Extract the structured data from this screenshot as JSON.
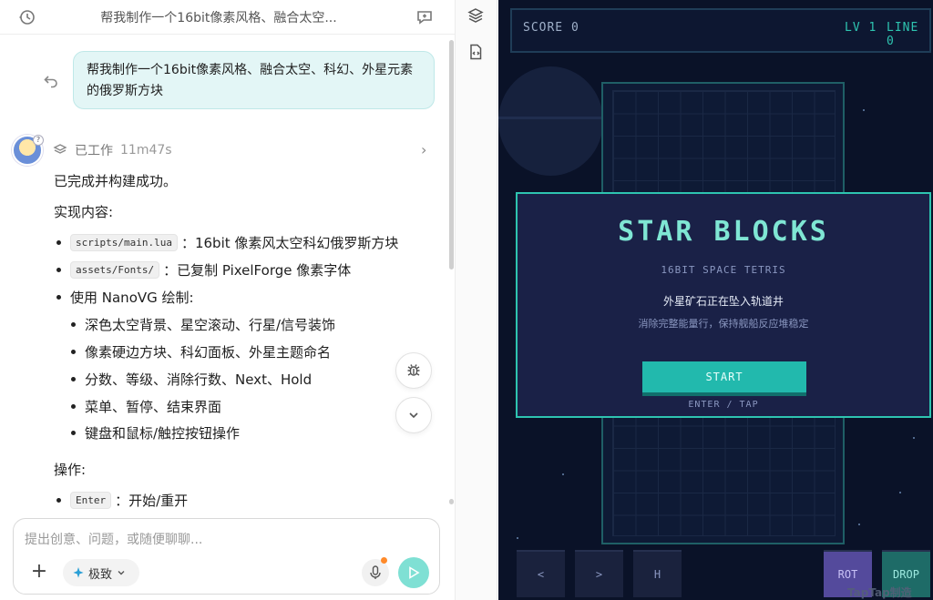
{
  "chat": {
    "title": "帮我制作一个16bit像素风格、融合太空...",
    "user_message_line1": "帮我制作一个16bit像素风格、融合太空、科幻、外星元素",
    "user_message_line2": "的俄罗斯方块",
    "work_label": "已工作",
    "work_duration": "11m47s",
    "done_text": "已完成并构建成功。",
    "impl_heading": "实现内容:",
    "items": [
      {
        "code": "scripts/main.lua",
        "text": "：16bit 像素风太空科幻俄罗斯方块"
      },
      {
        "code": "assets/Fonts/",
        "text": "：已复制 PixelForge 像素字体"
      },
      {
        "text": "使用 NanoVG 绘制:"
      }
    ],
    "sub_items": [
      "深色太空背景、星空滚动、行星/信号装饰",
      "像素硬边方块、科幻面板、外星主题命名",
      "分数、等级、消除行数、Next、Hold",
      "菜单、暂停、结束界面",
      "键盘和鼠标/触控按钮操作"
    ],
    "ops_heading": "操作:",
    "ops_items": [
      {
        "code": "Enter",
        "text": "：开始/重开"
      }
    ],
    "composer_placeholder": "提出创意、问题，或随便聊聊...",
    "mode_label": "极致"
  },
  "game": {
    "hud_score": "SCORE 0",
    "hud_level": "LV 1",
    "hud_line": "LINE 0",
    "title": "STAR BLOCKS",
    "subtitle": "16BIT SPACE TETRIS",
    "line1": "外星矿石正在坠入轨道井",
    "line2": "消除完整能量行，保持舰船反应堆稳定",
    "start_label": "START",
    "start_hint": "ENTER / TAP",
    "controls": [
      "<",
      ">",
      "H",
      "ROT",
      "DROP"
    ],
    "watermark": "TapTap制造"
  },
  "colors": {
    "accent": "#2ec4b0",
    "bubble_bg": "#e3f6f6",
    "game_bg": "#0a1228",
    "send_button": "#7fe0d4"
  },
  "icons": {
    "header_left": "history-icon",
    "header_right": "new-chat-icon",
    "rail_1": "layers-icon",
    "rail_2": "code-file-icon"
  }
}
